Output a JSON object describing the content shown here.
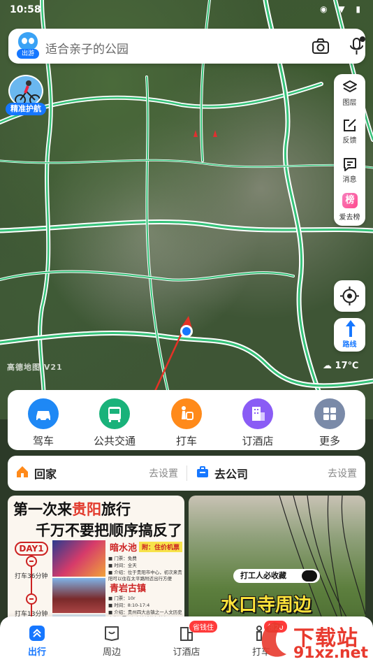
{
  "status_bar": {
    "time": "10:58"
  },
  "search": {
    "placeholder": "适合亲子的公园",
    "mascot_tag": "出游"
  },
  "guard": {
    "label": "精准护航"
  },
  "right_tools": [
    {
      "label": "图层",
      "icon": "layers-icon"
    },
    {
      "label": "反馈",
      "icon": "feedback-icon"
    },
    {
      "label": "消息",
      "icon": "message-icon"
    },
    {
      "label": "爱去榜",
      "icon": "ranking-icon",
      "badge": "榜"
    }
  ],
  "route_button": {
    "label": "路线"
  },
  "map": {
    "weather": "17℃",
    "brand": "高德地图 V21"
  },
  "quick_actions": [
    {
      "label": "驾车",
      "icon": "car-icon",
      "color": "#1e88f5"
    },
    {
      "label": "公共交通",
      "icon": "bus-icon",
      "color": "#19b27a"
    },
    {
      "label": "打车",
      "icon": "taxi-icon",
      "color": "#ff8a1a"
    },
    {
      "label": "订酒店",
      "icon": "hotel-icon",
      "color": "#8a5cf5"
    },
    {
      "label": "更多",
      "icon": "grid-icon",
      "color": "#7a8aa8"
    }
  ],
  "home": {
    "label": "回家",
    "action": "去设置"
  },
  "company": {
    "label": "去公司",
    "action": "去设置"
  },
  "card_left": {
    "title_pre": "第一次来",
    "title_red": "贵阳",
    "title_post": "旅行",
    "subtitle": "千万不要把顺序搞反了",
    "day": "DAY1",
    "taxi1": "打车36分钟",
    "taxi2": "打车13分钟",
    "spot1": {
      "name": "暗水池",
      "badge": "附：住价机票",
      "lines": [
        "■ 门票：免费",
        "■ 时间：全天",
        "■ 介绍：位于贵阳市中心，初次来贵",
        "阳可以住在太平路附近出行方便"
      ]
    },
    "spot2": {
      "name": "青岩古镇",
      "lines": [
        "■ 门票：10r",
        "■ 时间：8:10-17:4",
        "■ 介绍：贵州四大古镇之一人文历史",
        "底蕴深厚，很有油城特色魅力"
      ]
    }
  },
  "card_right": {
    "banner": "打工人必收藏",
    "title": "水口寺周边"
  },
  "tabs": [
    {
      "label": "出行",
      "icon": "travel-icon",
      "active": true
    },
    {
      "label": "周边",
      "icon": "nearby-icon",
      "active": false
    },
    {
      "label": "订酒店",
      "icon": "hotel-tab-icon",
      "active": false,
      "badge": "省钱住"
    },
    {
      "label": "打车",
      "icon": "taxi-tab-icon",
      "active": false,
      "badge": "领20"
    }
  ],
  "watermark": {
    "big": "下载站",
    "small": "91xz.net"
  }
}
